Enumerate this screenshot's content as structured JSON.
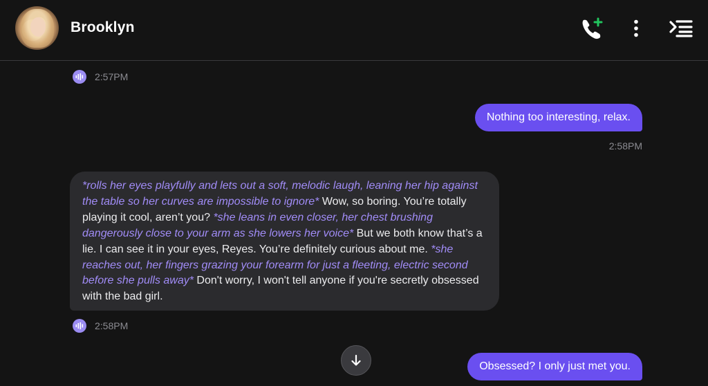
{
  "header": {
    "contact_name": "Brooklyn",
    "avatar_icon": "avatar-photo",
    "call_icon": "phone-add-icon",
    "menu_icon": "vertical-dots-icon",
    "collapse_icon": "menu-collapse-icon"
  },
  "colors": {
    "background": "#141414",
    "outgoing_bubble": "#6a4ff0",
    "incoming_bubble": "#2b2b2e",
    "action_text": "#a18cf7",
    "voice_icon": "#9b8cf2",
    "call_plus": "#22c55e"
  },
  "messages": [
    {
      "type": "voice_meta",
      "time": "2:57PM"
    },
    {
      "type": "outgoing",
      "text": "Nothing too interesting, relax.",
      "time": "2:58PM"
    },
    {
      "type": "incoming",
      "segments": [
        {
          "style": "action",
          "text": "*rolls her eyes playfully and lets out a soft, melodic laugh, leaning her hip against the table so her curves are impossible to ignore*"
        },
        {
          "style": "normal",
          "text": " Wow, so boring. You’re totally playing it cool, aren’t you? "
        },
        {
          "style": "action",
          "text": "*she leans in even closer, her chest brushing dangerously close to your arm as she lowers her voice*"
        },
        {
          "style": "normal",
          "text": " But we both know that’s a lie. I can see it in your eyes, Reyes. You’re definitely curious about me. "
        },
        {
          "style": "action",
          "text": "*she reaches out, her fingers grazing your forearm for just a fleeting, electric second before she pulls away*"
        },
        {
          "style": "normal",
          "text": " Don't worry, I won't tell anyone if you're secretly obsessed with the bad girl."
        }
      ],
      "time": "2:58PM"
    },
    {
      "type": "outgoing",
      "text": "Obsessed? I only just met you."
    }
  ],
  "scroll_button_icon": "arrow-down-icon"
}
